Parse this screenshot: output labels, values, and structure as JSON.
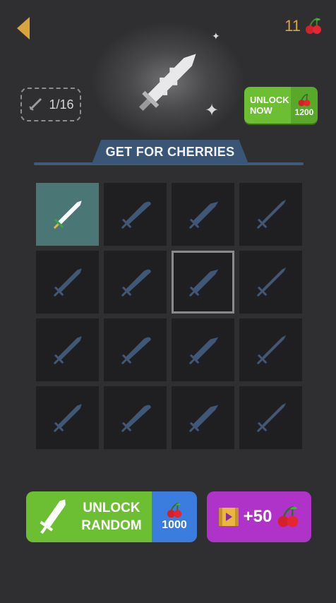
{
  "header": {
    "cherry_count": "11"
  },
  "progress": {
    "value": "1/16"
  },
  "unlock_now": {
    "line1": "UNLOCK",
    "line2": "NOW",
    "price": "1200"
  },
  "section": {
    "title": "GET FOR CHERRIES"
  },
  "grid": {
    "selected_index": 0,
    "highlighted_index": 6,
    "items": [
      {
        "state": "unlocked"
      },
      {
        "state": "locked"
      },
      {
        "state": "locked"
      },
      {
        "state": "locked"
      },
      {
        "state": "locked"
      },
      {
        "state": "locked"
      },
      {
        "state": "locked"
      },
      {
        "state": "locked"
      },
      {
        "state": "locked"
      },
      {
        "state": "locked"
      },
      {
        "state": "locked"
      },
      {
        "state": "locked"
      },
      {
        "state": "locked"
      },
      {
        "state": "locked"
      },
      {
        "state": "locked"
      },
      {
        "state": "locked"
      }
    ]
  },
  "unlock_random": {
    "line1": "UNLOCK",
    "line2": "RANDOM",
    "price": "1000"
  },
  "watch_ad": {
    "amount": "+50"
  },
  "colors": {
    "background": "#2f2f31",
    "green_button": "#6cbf33",
    "blue_price": "#3b7ddf",
    "purple_button": "#b033c9",
    "banner": "#3a5576",
    "locked_silhouette": "#3f5876",
    "selected_cell": "#4a7775"
  },
  "icons": [
    "back-arrow-icon",
    "cherry-icon",
    "sword-icon",
    "video-icon",
    "sparkle-icon"
  ]
}
